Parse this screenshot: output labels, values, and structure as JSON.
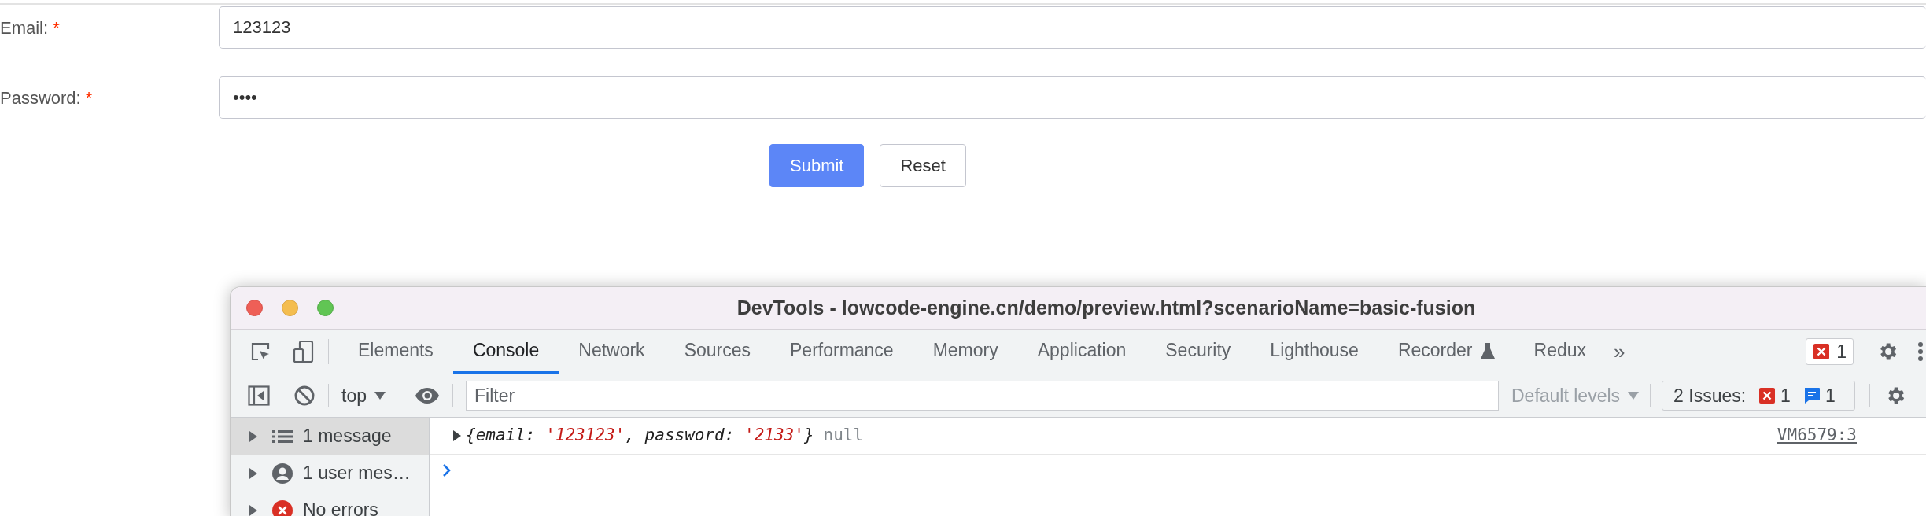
{
  "form": {
    "fields": [
      {
        "label": "Email:",
        "required_mark": "*",
        "value": "123123"
      },
      {
        "label": "Password:",
        "required_mark": "*",
        "value": "••••"
      }
    ],
    "buttons": [
      {
        "label": "Submit",
        "kind": "primary"
      },
      {
        "label": "Reset",
        "kind": "default"
      }
    ]
  },
  "devtools": {
    "title": "DevTools - lowcode-engine.cn/demo/preview.html?scenarioName=basic-fusion",
    "tabs": [
      {
        "label": "Elements",
        "selected": false,
        "experimental": false
      },
      {
        "label": "Console",
        "selected": true,
        "experimental": false
      },
      {
        "label": "Network",
        "selected": false,
        "experimental": false
      },
      {
        "label": "Sources",
        "selected": false,
        "experimental": false
      },
      {
        "label": "Performance",
        "selected": false,
        "experimental": false
      },
      {
        "label": "Memory",
        "selected": false,
        "experimental": false
      },
      {
        "label": "Application",
        "selected": false,
        "experimental": false
      },
      {
        "label": "Security",
        "selected": false,
        "experimental": false
      },
      {
        "label": "Lighthouse",
        "selected": false,
        "experimental": false
      },
      {
        "label": "Recorder",
        "selected": false,
        "experimental": true
      },
      {
        "label": "Redux",
        "selected": false,
        "experimental": false
      }
    ],
    "more": "»",
    "error_count": "1",
    "toolbar": {
      "context": "top",
      "filter_placeholder": "Filter",
      "levels": "Default levels",
      "issues_label": "2 Issues:",
      "issue_counts": [
        {
          "kind": "error",
          "count": "1"
        },
        {
          "kind": "info",
          "count": "1"
        }
      ]
    },
    "sidebar": [
      {
        "label": "1 message",
        "kind": "messages",
        "selected": true
      },
      {
        "label": "1 user mes…",
        "kind": "user",
        "selected": false
      },
      {
        "label": "No errors",
        "kind": "errors",
        "selected": false
      }
    ],
    "entries": [
      {
        "tokens": [
          {
            "text": "{email: ",
            "kind": "key"
          },
          {
            "text": "'123123'",
            "kind": "string"
          },
          {
            "text": ", password: ",
            "kind": "key"
          },
          {
            "text": "'2133'",
            "kind": "string"
          },
          {
            "text": "}",
            "kind": "key"
          },
          {
            "text": "null",
            "kind": "null"
          }
        ],
        "source": "VM6579:3"
      }
    ]
  }
}
